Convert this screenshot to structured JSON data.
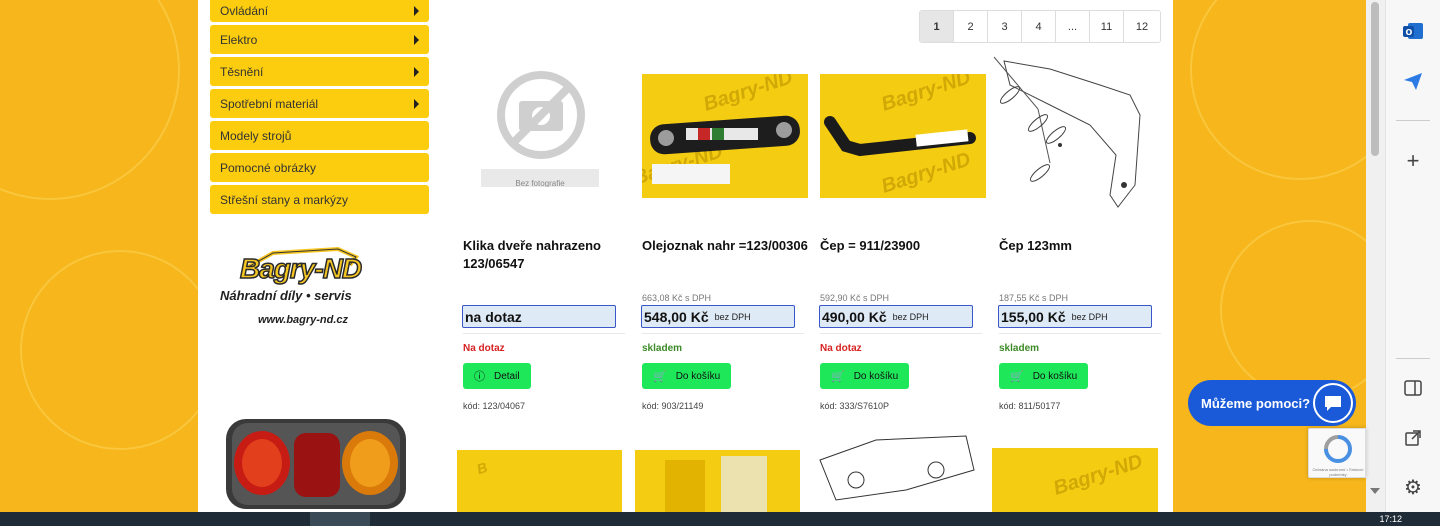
{
  "sidebar": {
    "items": [
      {
        "label": "Ovládání",
        "has_arrow": true
      },
      {
        "label": "Elektro",
        "has_arrow": true
      },
      {
        "label": "Těsnění",
        "has_arrow": true
      },
      {
        "label": "Spotřební materiál",
        "has_arrow": true
      },
      {
        "label": "Modely strojů",
        "has_arrow": false
      },
      {
        "label": "Pomocné obrázky",
        "has_arrow": false
      },
      {
        "label": "Střešní stany a markýzy",
        "has_arrow": false
      }
    ]
  },
  "logo": {
    "name": "Bagry-ND",
    "tagline": "Náhradní díly • servis",
    "url": "www.bagry-nd.cz"
  },
  "pagination": {
    "pages": [
      "1",
      "2",
      "3",
      "4",
      "...",
      "11",
      "12"
    ],
    "active": "1"
  },
  "products": [
    {
      "title": "Klika dveře nahrazeno 123/06547",
      "image": "no-photo",
      "no_photo_label": "Bez fotografie",
      "old_price": "",
      "price": "na dotaz",
      "vat_label": "",
      "stock": "Na dotaz",
      "stock_status": "red",
      "button": "Detail",
      "button_icon": "info-icon",
      "code": "kód: 123/04067"
    },
    {
      "title": "Olejoznak nahr =123/00306",
      "image": "photo",
      "old_price": "663,08 Kč s DPH",
      "price": "548,00 Kč",
      "vat_label": "bez DPH",
      "stock": "skladem",
      "stock_status": "green",
      "button": "Do košíku",
      "button_icon": "cart-icon",
      "code": "kód: 903/21149"
    },
    {
      "title": "Čep = 911/23900",
      "image": "photo",
      "old_price": "592,90 Kč s DPH",
      "price": "490,00 Kč",
      "vat_label": "bez DPH",
      "stock": "Na dotaz",
      "stock_status": "red",
      "button": "Do košíku",
      "button_icon": "cart-icon",
      "code": "kód: 333/S7610P"
    },
    {
      "title": "Čep 123mm",
      "image": "drawing",
      "old_price": "187,55 Kč s DPH",
      "price": "155,00 Kč",
      "vat_label": "bez DPH",
      "stock": "skladem",
      "stock_status": "green",
      "button": "Do košíku",
      "button_icon": "cart-icon",
      "code": "kód: 811/50177"
    }
  ],
  "watermark": "Bagry-ND",
  "chat": {
    "label": "Můžeme pomoci?"
  },
  "recaptcha": {
    "text": "Ochrana soukromí • Smluvní podmínky"
  },
  "taskbar": {
    "clock": "17:12"
  },
  "colors": {
    "accent_yellow": "#fccd0e",
    "button_green": "#1ee85a",
    "price_border": "#3a56c9",
    "chat_blue": "#1a5ad9"
  }
}
